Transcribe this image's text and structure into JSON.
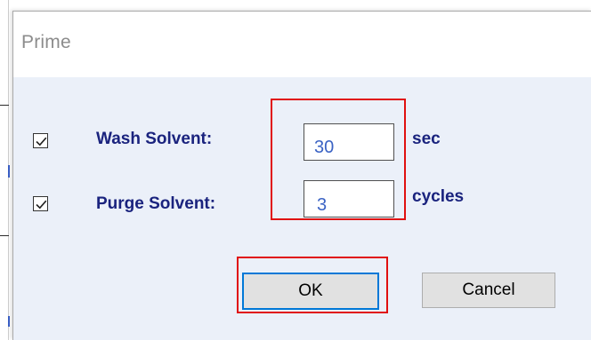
{
  "dialog": {
    "title": "Prime"
  },
  "fields": {
    "wash": {
      "checked": true,
      "label": "Wash Solvent:",
      "value": "30",
      "unit": "sec"
    },
    "purge": {
      "checked": true,
      "label": "Purge Solvent:",
      "value": "3",
      "unit": "cycles"
    }
  },
  "buttons": {
    "ok_label": "OK",
    "cancel_label": "Cancel"
  },
  "colors": {
    "label_text": "#1a237e",
    "value_text": "#3b63c4",
    "dialog_body": "#ebf0f9",
    "highlight_box": "#e01010",
    "focus_border": "#0078d7"
  }
}
